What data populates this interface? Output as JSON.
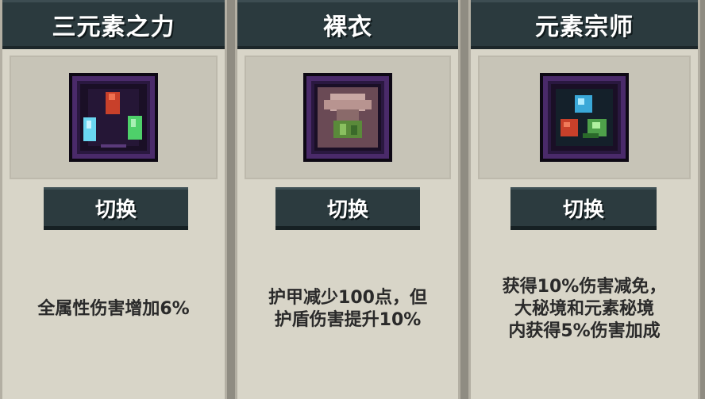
{
  "cards": [
    {
      "title": "三元素之力",
      "icon": "three-elements-icon",
      "button": "切换",
      "description": [
        "全属性伤害增加6%"
      ]
    },
    {
      "title": "裸衣",
      "icon": "bare-clothes-icon",
      "button": "切换",
      "description": [
        "护甲减少100点，但",
        "护盾伤害提升10%"
      ]
    },
    {
      "title": "元素宗师",
      "icon": "element-master-icon",
      "button": "切换",
      "description": [
        "获得10%伤害减免，",
        "大秘境和元素秘境",
        "内获得5%伤害加成"
      ]
    }
  ],
  "colors": {
    "header": "#2b3a3e",
    "card_bg": "#d8d5c8",
    "icon_frame": "#4a2a6a",
    "fire": "#c8402a",
    "ice": "#6ad6f0",
    "nature": "#4ed06a"
  }
}
